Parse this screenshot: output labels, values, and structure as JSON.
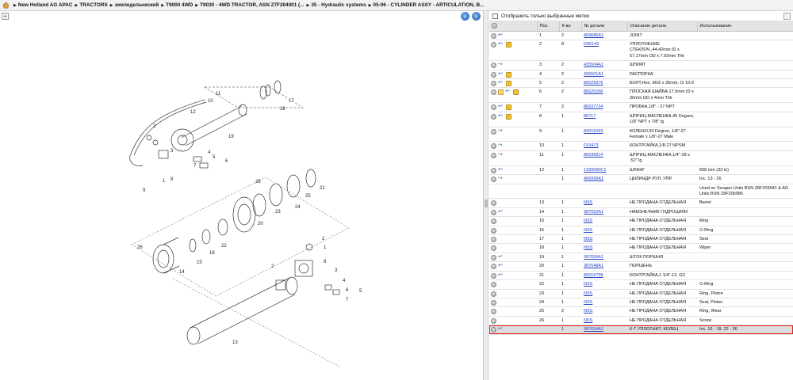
{
  "breadcrumb": {
    "items": [
      "New Holland AG APAC",
      "TRACTORS",
      "земледельческий",
      "T9000 4WD",
      "T9030 - 4WD TRACTOR, ASN Z7F204001 (...",
      "35 - Hydraulic systems",
      "05-06 - CYLINDER ASSY - ARTICULATION, B..."
    ]
  },
  "toolbar": {
    "plus": "+",
    "back": "‹",
    "forward": "›"
  },
  "filter": {
    "label": "Отобразить только выбранные метки"
  },
  "table": {
    "headers": [
      "Поз.",
      "К-во",
      "№ детали",
      "Описание детали",
      "Использование"
    ],
    "rows": [
      {
        "icons": [
          "dot",
          "blue"
        ],
        "pos": "1",
        "qty": "2",
        "part": "409685A1",
        "desc": "JOINT",
        "usage": ""
      },
      {
        "icons": [
          "dot",
          "blue",
          "box"
        ],
        "pos": "2",
        "qty": "8",
        "part": "D95143",
        "desc": "УПЛОТНЕНИЕ СТЕКЛОЧ.,44.42mm ID x 57.17mm OD x 7.92mm Thk",
        "usage": ""
      },
      {
        "icons": [
          "dot",
          "green"
        ],
        "pos": "3",
        "qty": "2",
        "part": "435504A1",
        "desc": "ШПИФТ",
        "usage": ""
      },
      {
        "icons": [
          "dot",
          "blue",
          "box"
        ],
        "pos": "4",
        "qty": "2",
        "part": "435501A1",
        "desc": "РАСПОРКА",
        "usage": ""
      },
      {
        "icons": [
          "dot",
          "blue",
          "box"
        ],
        "pos": "5",
        "qty": "2",
        "part": "86529976",
        "desc": "БОЛТ,Hex, M16 x 35mm, Cl 10.9",
        "usage": ""
      },
      {
        "icons": [
          "dot",
          "note",
          "blue",
          "box"
        ],
        "pos": "6",
        "qty": "2",
        "part": "86625266",
        "desc": "ПЛОСКАЯ ШАЙБА,17.5mm ID x 30mm OD x 4mm Thk",
        "usage": ""
      },
      {
        "icons": [
          "dot",
          "blue",
          "box"
        ],
        "pos": "7",
        "qty": "2",
        "part": "86637724",
        "desc": "ПРОБКА,1/8\" - 27 NPT",
        "usage": ""
      },
      {
        "icons": [
          "dot",
          "blue",
          "box"
        ],
        "pos": "8",
        "qty": "1",
        "part": "86717",
        "desc": "ШПРИЦ-МАСЛЕНКА,45 Degree, 1/8\" NPT x 7/8\" lg",
        "usage": ""
      },
      {
        "icons": [
          "dot",
          "green"
        ],
        "pos": "9",
        "qty": "1",
        "part": "84015293",
        "desc": "КОЛЕНО,90 Degree, 1/8\"-27 Female x 1/8\"-27 Male",
        "usage": ""
      },
      {
        "icons": [
          "dot",
          "green"
        ],
        "pos": "10",
        "qty": "1",
        "part": "F53473",
        "desc": "КОНТРГАЙКА,1/8-27 NPSM",
        "usage": ""
      },
      {
        "icons": [
          "dot",
          "green"
        ],
        "pos": "11",
        "qty": "1",
        "part": "86636814",
        "desc": "ШПРИЦ-МАСЛЕНКА,1/4\"-28 x .52\" lg",
        "usage": ""
      },
      {
        "icons": [
          "dot",
          "blue"
        ],
        "pos": "12",
        "qty": "1",
        "part": "1339090C1",
        "desc": "ШЛАНГ",
        "usage": "838 mm (33 in)"
      },
      {
        "icons": [
          "dot",
          "green"
        ],
        "pos": "",
        "qty": "1",
        "part": "406999A1",
        "desc": "ЦИЛИНДР РУЛ. УПР.",
        "usage": "Inc. 13 - 26"
      },
      {
        "icons": [],
        "pos": "",
        "qty": "",
        "part": "",
        "desc": "",
        "usage": "Used on Scraper Units BSN Z8F205941 & AG Units BSN Z8F205986"
      },
      {
        "icons": [
          "dot"
        ],
        "pos": "13",
        "qty": "1",
        "part": "NSS",
        "desc": "НЕ ПРОДАНА ОТДЕЛЬНАЯ",
        "usage": "Barrel"
      },
      {
        "icons": [
          "dot",
          "blue"
        ],
        "pos": "14",
        "qty": "1",
        "part": "387652A1",
        "desc": "НАКОНЕЧНИК ГИДРОЦИЛИ",
        "usage": ""
      },
      {
        "icons": [
          "dot"
        ],
        "pos": "15",
        "qty": "1",
        "part": "NSS",
        "desc": "НЕ ПРОДАНА ОТДЕЛЬНАЯ",
        "usage": "Ring"
      },
      {
        "icons": [
          "dot"
        ],
        "pos": "16",
        "qty": "1",
        "part": "NSS",
        "desc": "НЕ ПРОДАНА ОТДЕЛЬНАЯ",
        "usage": "O-Ring"
      },
      {
        "icons": [
          "dot"
        ],
        "pos": "17",
        "qty": "1",
        "part": "NSS",
        "desc": "НЕ ПРОДАНА ОТДЕЛЬНАЯ",
        "usage": "Seal"
      },
      {
        "icons": [
          "dot"
        ],
        "pos": "18",
        "qty": "1",
        "part": "NSS",
        "desc": "НЕ ПРОДАНА ОТДЕЛЬНАЯ",
        "usage": "Wiper"
      },
      {
        "icons": [
          "dot",
          "blue"
        ],
        "pos": "19",
        "qty": "1",
        "part": "387650A1",
        "desc": "ШТОК ПОРШНЯ",
        "usage": ""
      },
      {
        "icons": [
          "dot",
          "blue"
        ],
        "pos": "20",
        "qty": "1",
        "part": "387648A1",
        "desc": "ПОРШЕНЬ",
        "usage": ""
      },
      {
        "icons": [
          "dot",
          "blue"
        ],
        "pos": "21",
        "qty": "1",
        "part": "86016798",
        "desc": "КОНТРГАЙКА,1 1/4\"-12, GC",
        "usage": ""
      },
      {
        "icons": [
          "dot"
        ],
        "pos": "22",
        "qty": "1",
        "part": "NSS",
        "desc": "НЕ ПРОДАНА ОТДЕЛЬНАЯ",
        "usage": "O-Ring"
      },
      {
        "icons": [
          "dot"
        ],
        "pos": "23",
        "qty": "1",
        "part": "NSS",
        "desc": "НЕ ПРОДАНА ОТДЕЛЬНАЯ",
        "usage": "Ring, Piston"
      },
      {
        "icons": [
          "dot"
        ],
        "pos": "24",
        "qty": "1",
        "part": "NSS",
        "desc": "НЕ ПРОДАНА ОТДЕЛЬНАЯ",
        "usage": "Seal, Piston"
      },
      {
        "icons": [
          "dot"
        ],
        "pos": "25",
        "qty": "2",
        "part": "NSS",
        "desc": "НЕ ПРОДАНА ОТДЕЛЬНАЯ",
        "usage": "Ring, Wear"
      },
      {
        "icons": [
          "dot"
        ],
        "pos": "26",
        "qty": "1",
        "part": "NSS",
        "desc": "НЕ ПРОДАНА ОТДЕЛЬНАЯ",
        "usage": "Screw"
      },
      {
        "icons": [
          "dot",
          "blue"
        ],
        "pos": "",
        "qty": "1",
        "part": "387654A1",
        "desc": "К-Т УПЛОТНИТ. КОЛЕЦ",
        "usage": "Inc. 15 - 18, 22 - 26",
        "selected": true
      }
    ]
  },
  "diagram": {
    "callouts": [
      "11",
      "10",
      "12",
      "18",
      "17",
      "19",
      "2",
      "3",
      "4",
      "5",
      "6",
      "7",
      "8",
      "1",
      "9",
      "21",
      "25",
      "24",
      "26",
      "23",
      "20",
      "22",
      "15",
      "16",
      "14",
      "26",
      "2",
      "2",
      "1",
      "8",
      "3",
      "4",
      "6",
      "5",
      "7",
      "13"
    ]
  }
}
